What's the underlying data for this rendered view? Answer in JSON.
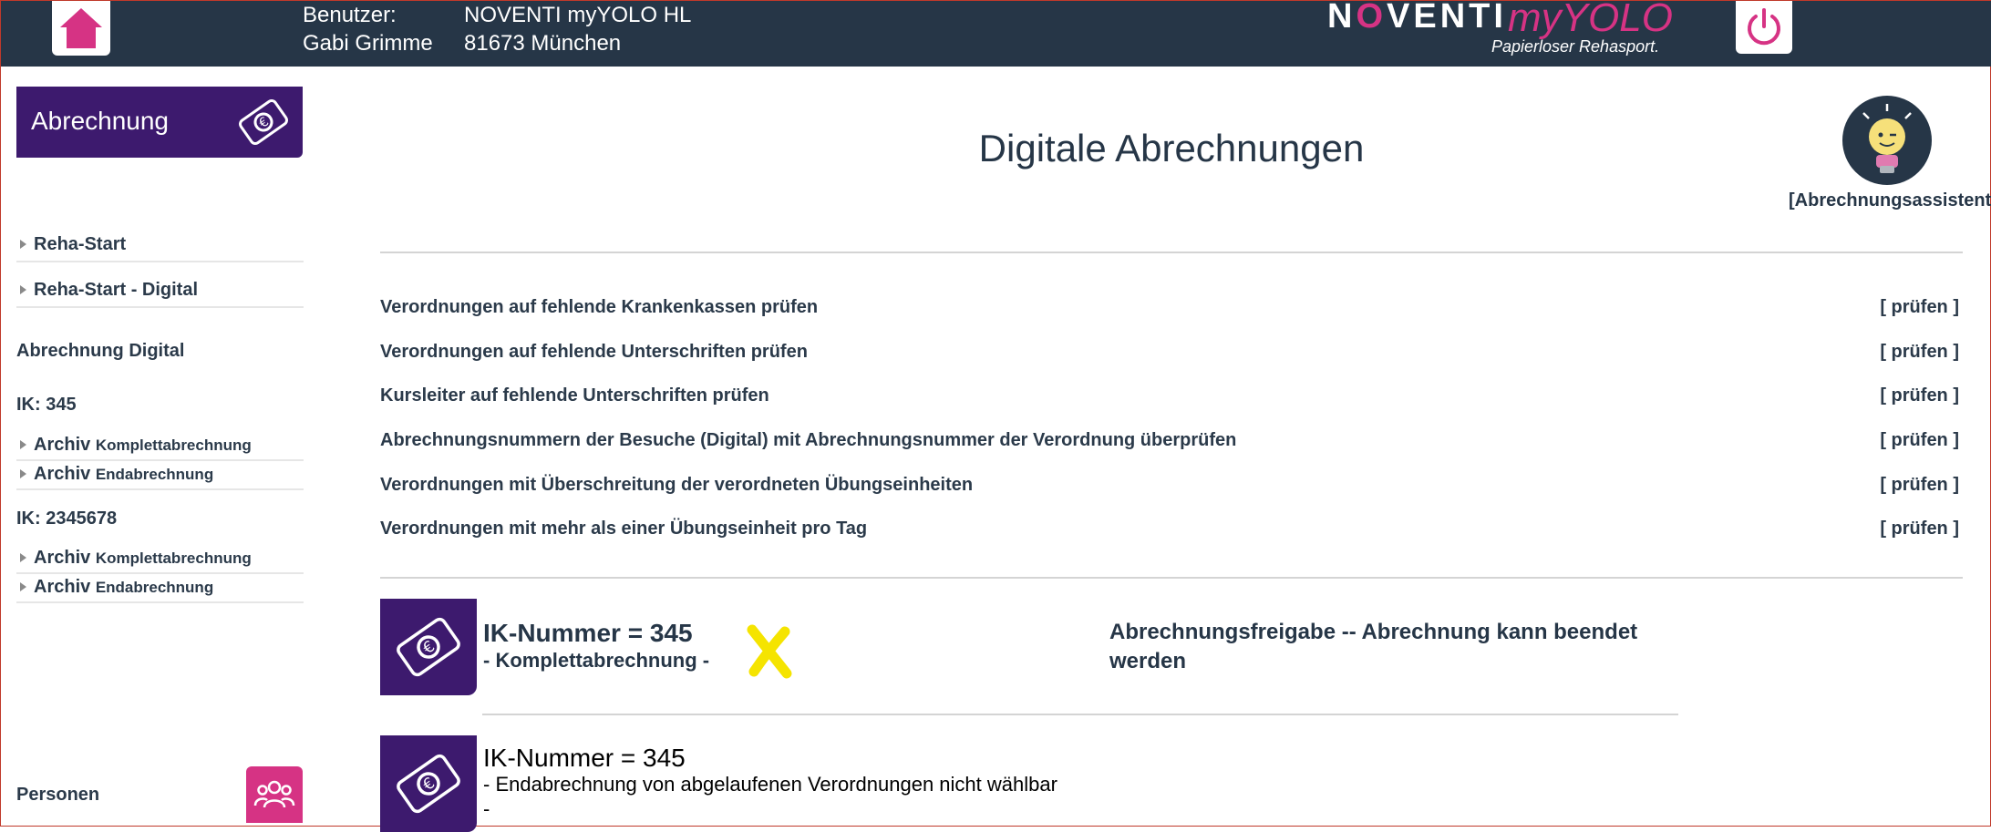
{
  "header": {
    "user_label": "Benutzer:",
    "user_name": "Gabi Grimme",
    "org_name": "NOVENTI myYOLO HL",
    "org_city": "81673 München",
    "logo_noventi_a": "N",
    "logo_noventi_o": "O",
    "logo_noventi_b": "VENTI",
    "logo_myyolo": "myYOLO",
    "logo_tagline": "Papierloser Rehasport."
  },
  "sidebar": {
    "section_label": "Abrechnung",
    "links": [
      {
        "label": "Reha-Start"
      },
      {
        "label": "Reha-Start - Digital"
      }
    ],
    "digital_heading": "Abrechnung Digital",
    "ik_groups": [
      {
        "ik": "IK: 345",
        "items": [
          {
            "a": "Archiv",
            "b": "Komplettabrechnung"
          },
          {
            "a": "Archiv",
            "b": "Endabrechnung"
          }
        ]
      },
      {
        "ik": "IK: 2345678",
        "items": [
          {
            "a": "Archiv",
            "b": "Komplettabrechnung"
          },
          {
            "a": "Archiv",
            "b": "Endabrechnung"
          }
        ]
      }
    ],
    "persons_label": "Personen"
  },
  "main": {
    "title": "Digitale Abrechnungen",
    "assistant_label": "[Abrechnungsassistent]",
    "checks": [
      {
        "label": "Verordnungen auf fehlende Krankenkassen prüfen",
        "action": "[ prüfen ]"
      },
      {
        "label": "Verordnungen auf fehlende Unterschriften prüfen",
        "action": "[ prüfen ]"
      },
      {
        "label": "Kursleiter auf fehlende Unterschriften prüfen",
        "action": "[ prüfen ]"
      },
      {
        "label": "Abrechnungsnummern der Besuche (Digital) mit Abrechnungsnummer der Verordnung überprüfen",
        "action": "[ prüfen ]"
      },
      {
        "label": "Verordnungen mit Überschreitung der verordneten Übungseinheiten",
        "action": "[ prüfen ]"
      },
      {
        "label": "Verordnungen mit mehr als einer Übungseinheit pro Tag",
        "action": "[ prüfen ]"
      }
    ],
    "entries": [
      {
        "title": "IK-Nummer = 345",
        "subtitle": "- Komplettabrechnung -",
        "status": "Abrechnungsfreigabe -- Abrechnung kann beendet werden"
      },
      {
        "title": "IK-Nummer = 345",
        "line1": "- Endabrechnung von abgelaufenen Verordnungen nicht wählbar",
        "line2": "-"
      }
    ]
  },
  "colors": {
    "header_bg": "#263647",
    "brand_purple": "#3d1a6e",
    "brand_pink": "#d63384",
    "status_mark": "#f5e400"
  }
}
